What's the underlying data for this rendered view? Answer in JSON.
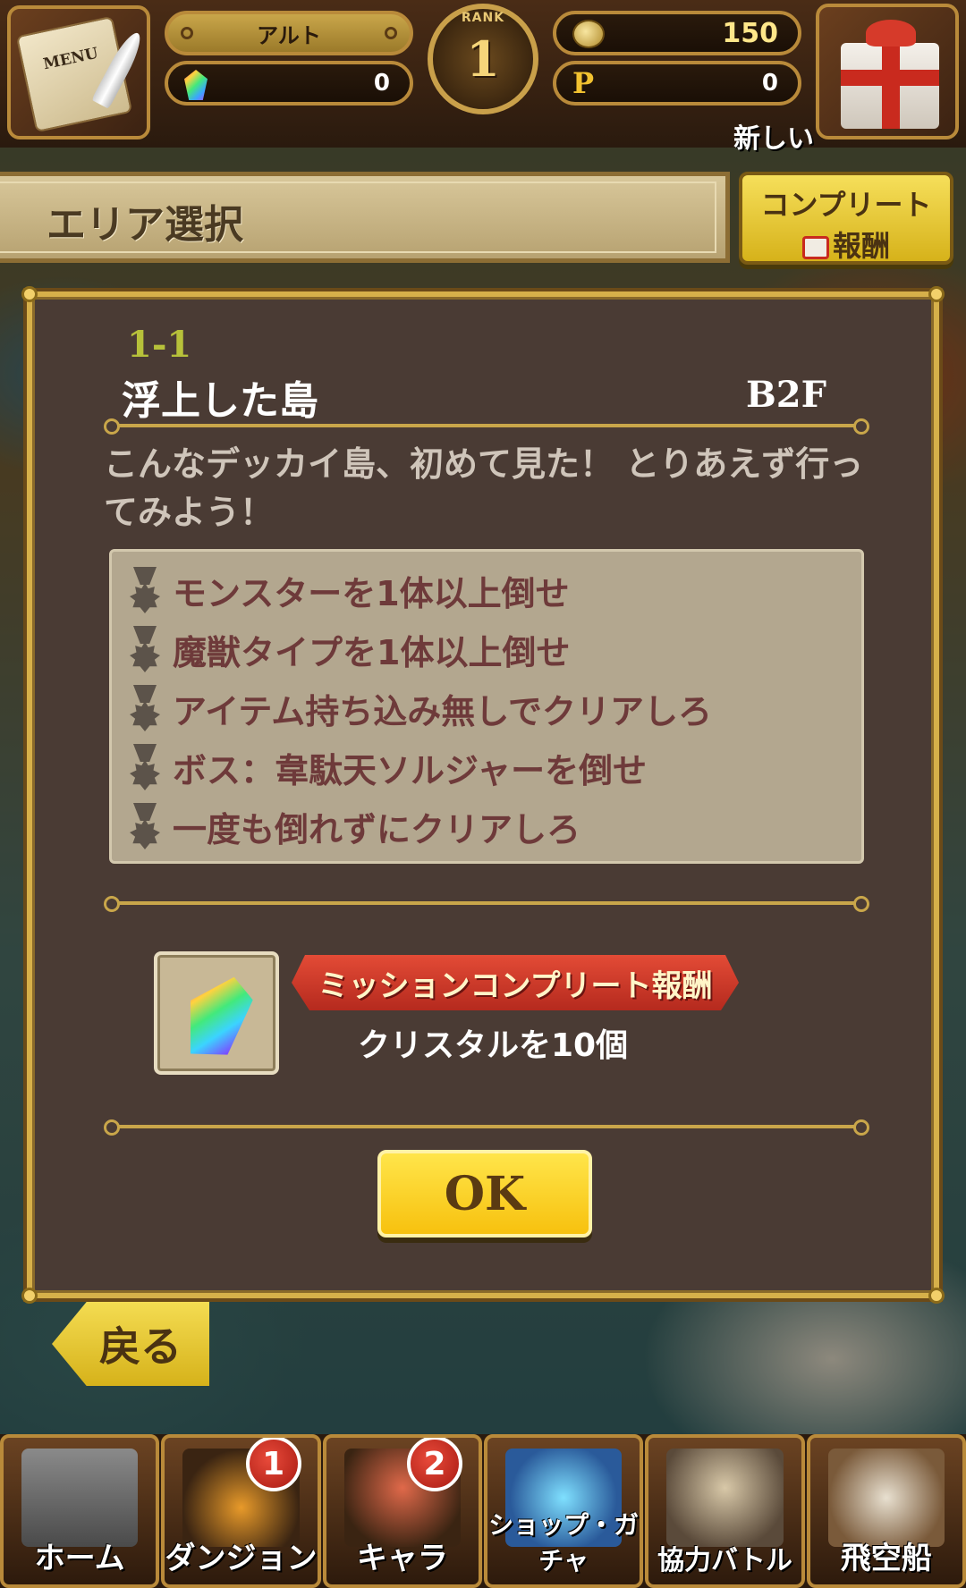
{
  "header": {
    "menu_label": "MENU",
    "player_name": "アルト",
    "crystal_count": "0",
    "rank_label": "RANK",
    "rank": "1",
    "coins": "150",
    "points_icon": "P",
    "points": "0",
    "ticker_text": "新しい"
  },
  "area_bar": {
    "title": "エリア選択",
    "complete_line1": "コンプリート",
    "complete_line2": "報酬"
  },
  "modal": {
    "stage_number": "1-1",
    "stage_name": "浮上した島",
    "floor": "B2F",
    "description": "こんなデッカイ島、初めて見た！ とりあえず行ってみよう！",
    "missions": [
      {
        "text": "モンスターを1体以上倒せ"
      },
      {
        "text": "魔獣タイプを1体以上倒せ"
      },
      {
        "text": "アイテム持ち込み無しでクリアしろ"
      },
      {
        "text": "ボス：韋駄天ソルジャーを倒せ"
      },
      {
        "text": "一度も倒れずにクリアしろ"
      }
    ],
    "reward_banner": "ミッションコンプリート報酬",
    "reward_desc": "クリスタルを10個",
    "ok_label": "OK"
  },
  "back_label": "戻る",
  "bottom_nav": [
    {
      "label": "ホーム",
      "icon": "castle-icon",
      "badge": ""
    },
    {
      "label": "ダンジョン",
      "icon": "dungeon-door-icon",
      "badge": "1"
    },
    {
      "label": "キャラ",
      "icon": "character-icon",
      "badge": "2"
    },
    {
      "label": "ショップ・ガチャ",
      "icon": "crystal-shop-icon",
      "badge": ""
    },
    {
      "label": "協力バトル",
      "icon": "coop-battle-icon",
      "badge": ""
    },
    {
      "label": "飛空船",
      "icon": "airship-icon",
      "badge": ""
    }
  ],
  "colors": {
    "gold_border": "#d6b04a",
    "modal_bg": "#4a3b34",
    "ok_button": "#f7c10e",
    "mission_text": "#6e3a3a",
    "stage_number": "#b7c13a"
  }
}
